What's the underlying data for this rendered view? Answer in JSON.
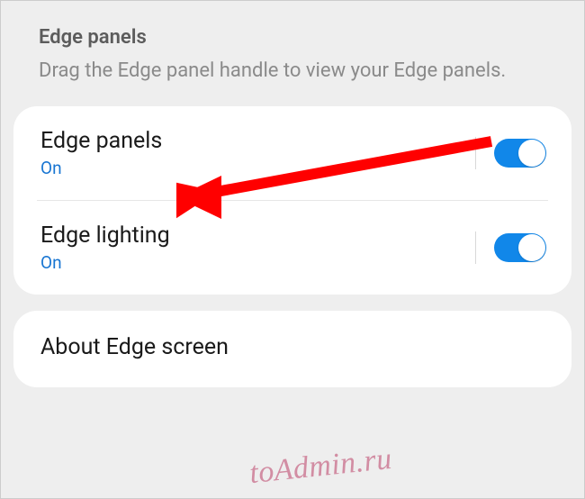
{
  "header": {
    "title": "Edge panels",
    "subtitle": "Drag the Edge panel handle to view your Edge panels."
  },
  "settings": {
    "edge_panels": {
      "title": "Edge panels",
      "status": "On",
      "toggled": true
    },
    "edge_lighting": {
      "title": "Edge lighting",
      "status": "On",
      "toggled": true
    }
  },
  "about": {
    "title": "About Edge screen"
  },
  "watermark": "toAdmin.ru",
  "colors": {
    "toggle_active": "#1187e9",
    "status_text": "#1976d2",
    "arrow": "#ff0000"
  }
}
